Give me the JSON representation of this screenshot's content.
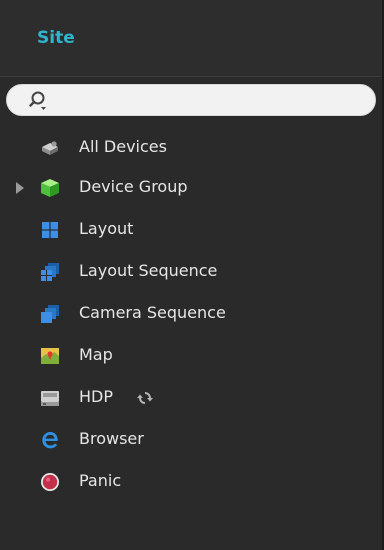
{
  "panel": {
    "title": "Site",
    "accent_color": "#2fb5cf"
  },
  "search": {
    "value": "",
    "placeholder": "",
    "icon": "search-dropdown-icon"
  },
  "tree": {
    "items": [
      {
        "label": "All Devices",
        "icon": "all-devices-icon",
        "expandable": false
      },
      {
        "label": "Device Group",
        "icon": "device-group-cube-icon",
        "expandable": true,
        "expanded": false
      },
      {
        "label": "Layout",
        "icon": "layout-grid-icon",
        "expandable": false
      },
      {
        "label": "Layout Sequence",
        "icon": "layout-sequence-icon",
        "expandable": false
      },
      {
        "label": "Camera Sequence",
        "icon": "camera-sequence-icon",
        "expandable": false
      },
      {
        "label": "Map",
        "icon": "map-icon",
        "expandable": false
      },
      {
        "label": "HDP",
        "icon": "hdp-icon",
        "expandable": false,
        "status_icon": "sync-icon"
      },
      {
        "label": "Browser",
        "icon": "browser-e-icon",
        "expandable": false
      },
      {
        "label": "Panic",
        "icon": "panic-icon",
        "expandable": false
      }
    ]
  }
}
